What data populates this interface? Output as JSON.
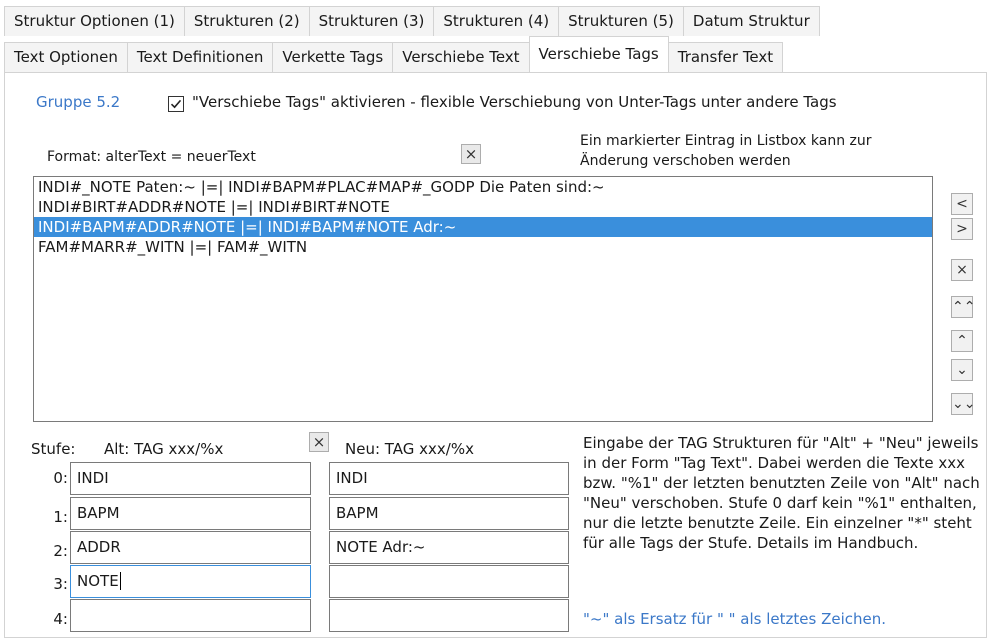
{
  "tabs_row1": [
    "Struktur Optionen (1)",
    "Strukturen (2)",
    "Strukturen (3)",
    "Strukturen (4)",
    "Strukturen (5)",
    "Datum Struktur"
  ],
  "tabs_row2": [
    "Text Optionen",
    "Text Definitionen",
    "Verkette Tags",
    "Verschiebe Text",
    "Verschiebe Tags",
    "Transfer Text"
  ],
  "active_tab": "Verschiebe Tags",
  "group_label": "Gruppe 5.2",
  "enable_checkbox": {
    "checked": true,
    "label": "\"Verschiebe Tags\" aktivieren - flexible Verschiebung von Unter-Tags unter andere Tags"
  },
  "format_label": "Format: alterText = neuerText",
  "info_text_line1": "Ein markierter Eintrag in Listbox kann zur",
  "info_text_line2": "Änderung verschoben werden",
  "clear_symbol": "×",
  "list_items": [
    "INDI#_NOTE Paten:~ |=| INDI#BAPM#PLAC#MAP#_GODP Die Paten sind:~",
    "INDI#BIRT#ADDR#NOTE |=| INDI#BIRT#NOTE",
    "INDI#BAPM#ADDR#NOTE |=| INDI#BAPM#NOTE Adr:~",
    "FAM#MARR#_WITN |=| FAM#_WITN"
  ],
  "selected_index": 2,
  "side_buttons": [
    "<",
    ">",
    "×",
    "⌃⌃",
    "⌃",
    "⌄",
    "⌄⌄"
  ],
  "stufe_label": "Stufe:",
  "alt_label": "Alt: TAG xxx/%x",
  "neu_label": "Neu: TAG xxx/%x",
  "levels": [
    "0:",
    "1:",
    "2:",
    "3:",
    "4:"
  ],
  "alt_values": [
    "INDI",
    "BAPM",
    "ADDR",
    "NOTE",
    ""
  ],
  "neu_values": [
    "INDI",
    "BAPM",
    "NOTE Adr:~",
    "",
    ""
  ],
  "description": "Eingabe der TAG Strukturen für \"Alt\" + \"Neu\" jeweils in der Form \"Tag Text\". Dabei werden die Texte xxx bzw. \"%1\" der letzten benutzten Zeile von \"Alt\" nach \"Neu\" verschoben. Stufe 0 darf kein \"%1\" enthalten, nur die letzte benutzte Zeile. Ein einzelner \"*\" steht für alle Tags der Stufe. Details im Handbuch.",
  "note": "\"~\" als Ersatz für \" \" als letztes Zeichen.",
  "colors": {
    "selection": "#3a8fdc",
    "accent_text": "#3b78c8"
  }
}
